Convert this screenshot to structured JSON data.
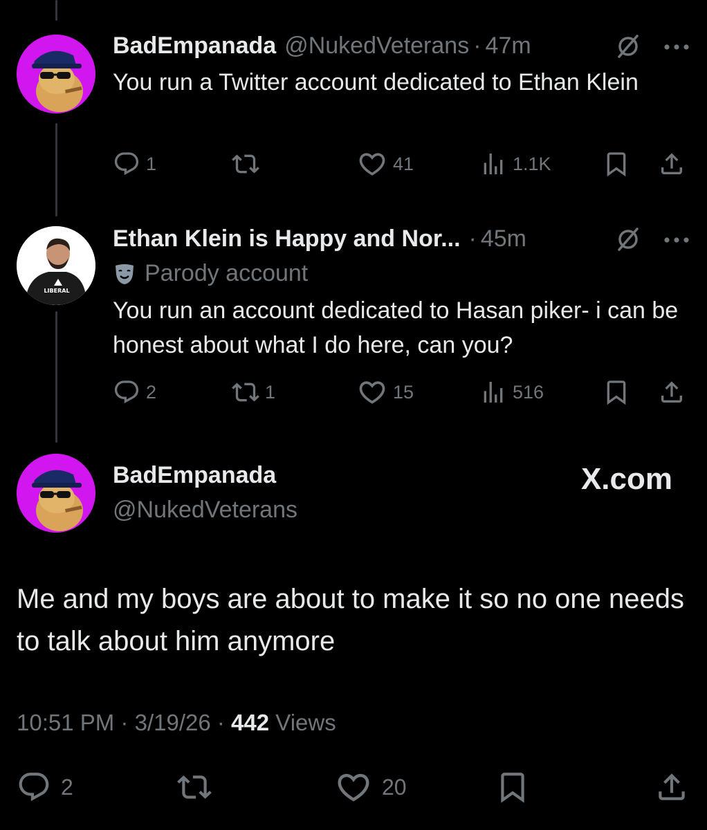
{
  "colors": {
    "background": "#000000",
    "text": "#e7e9ea",
    "secondary": "#71767b",
    "avatar_bg": "#d216f0"
  },
  "tweets": [
    {
      "name": "BadEmpanada",
      "handle": "@NukedVeterans",
      "dot": "·",
      "time": "47m",
      "text": "You run a Twitter account dedicated to Ethan Klein",
      "replies": "1",
      "retweets": "",
      "likes": "41",
      "views": "1.1K",
      "avatar": "cigar-smoking-empanada-avatar"
    },
    {
      "name": "Ethan Klein is Happy and Nor...",
      "dot": "·",
      "time": "45m",
      "parody_label": "Parody account",
      "text": "You run an account dedicated to Hasan piker- i can be honest about what I do here, can you?",
      "replies": "2",
      "retweets": "1",
      "likes": "15",
      "views": "516",
      "avatar": "man-in-liberal-tshirt-avatar"
    }
  ],
  "main_tweet": {
    "name": "BadEmpanada",
    "handle": "@NukedVeterans",
    "brand": "X.com",
    "text": "Me and my boys are about to make it so no one needs to talk about him anymore",
    "time": "10:51 PM",
    "date": "3/19/26",
    "separator": "·",
    "views_count": "442",
    "views_label": "Views",
    "replies": "2",
    "likes": "20"
  }
}
